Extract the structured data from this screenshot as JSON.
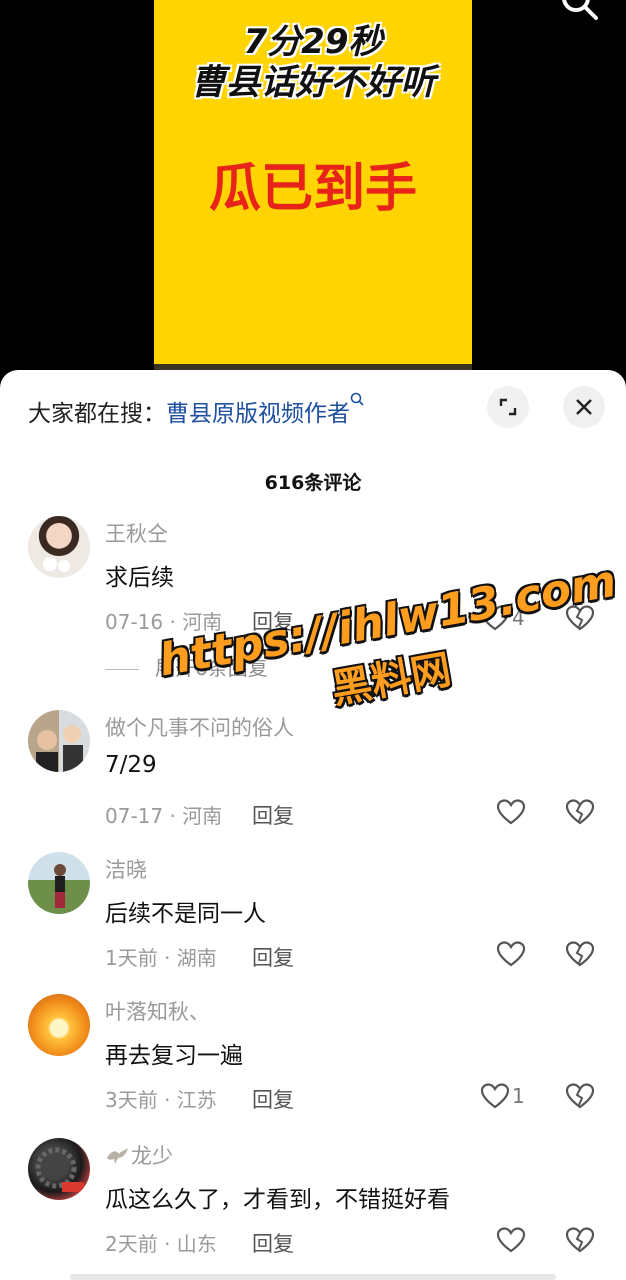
{
  "video": {
    "line1": "7分29秒",
    "line2": "曹县话好不好听",
    "line3": "瓜已到手"
  },
  "sheet": {
    "search_prefix": "大家都在搜：",
    "search_term": "曹县原版视频作者",
    "comment_count": "616条评论",
    "expand_replies": "展开6条回复"
  },
  "comments": [
    {
      "username": "王秋仝",
      "text": "求后续",
      "meta": "07-16 · 河南",
      "reply": "回复",
      "likes": "4"
    },
    {
      "username": "做个凡事不问的俗人",
      "text": "7/29",
      "meta": "07-17 · 河南",
      "reply": "回复",
      "likes": ""
    },
    {
      "username": "洁晓",
      "text": "后续不是同一人",
      "meta": "1天前 · 湖南",
      "reply": "回复",
      "likes": ""
    },
    {
      "username": "叶落知秋、",
      "text": "再去复习一遍",
      "meta": "3天前 · 江苏",
      "reply": "回复",
      "likes": "1"
    },
    {
      "username": "龙少",
      "text": "瓜这么久了，才看到，不错挺好看",
      "meta": "2天前 · 山东",
      "reply": "回复",
      "likes": ""
    }
  ],
  "watermark": {
    "url": "https://ihlw13.com",
    "name": "黑料网"
  },
  "colors": {
    "accent_link": "#1e4fa0",
    "video_bg": "#ffd400",
    "video_headline": "#e8231a",
    "watermark": "#ff9e1e"
  }
}
